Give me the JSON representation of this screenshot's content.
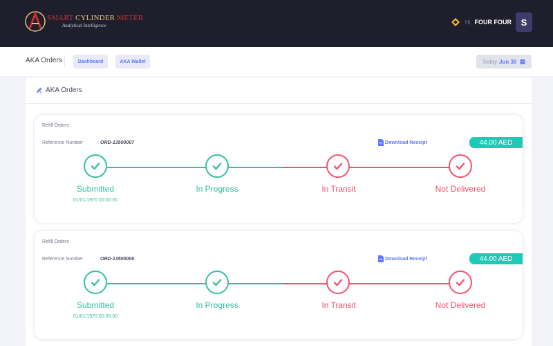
{
  "header": {
    "logo_title_a": "SMART ",
    "logo_title_b": "CYLINDER",
    "logo_title_c": " METER",
    "logo_tagline": "Analytical Intelligence",
    "greeting": "Hi,",
    "user_name": "FOUR FOUR",
    "avatar_letter": "S"
  },
  "subheader": {
    "title": "AKA Orders",
    "buttons": [
      "Dashboard",
      "AKA Wallet"
    ],
    "date_label": "Today",
    "date_value": "Jun 30"
  },
  "portlet": {
    "title": "AKA Orders"
  },
  "orders": [
    {
      "type": "Refill Orders",
      "ref_label": "Reference Number",
      "ref_colon": ":",
      "ref_number": "ORD-13500007",
      "download_label": "Download Receipt",
      "amount": "44.00 AED",
      "steps": [
        {
          "label": "Submitted",
          "status": "done",
          "date": "01/01/1970 00:00:00"
        },
        {
          "label": "In Progress",
          "status": "done"
        },
        {
          "label": "In Transit",
          "status": "failed"
        },
        {
          "label": "Not Delivered",
          "status": "failed"
        }
      ]
    },
    {
      "type": "Refill Orders",
      "ref_label": "Reference Number",
      "ref_colon": ":",
      "ref_number": "ORD-13500006",
      "download_label": "Download Receipt",
      "amount": "44.00 AED",
      "steps": [
        {
          "label": "Submitted",
          "status": "done",
          "date": "01/01/1970 00:00:00"
        },
        {
          "label": "In Progress",
          "status": "done"
        },
        {
          "label": "In Transit",
          "status": "failed"
        },
        {
          "label": "Not Delivered",
          "status": "failed"
        }
      ]
    }
  ],
  "colors": {
    "header_bg": "#1e1e2d",
    "accent": "#5d78ff",
    "success": "#34bfa3",
    "danger": "#f4516c",
    "amount_bg": "#1dc9b7"
  }
}
